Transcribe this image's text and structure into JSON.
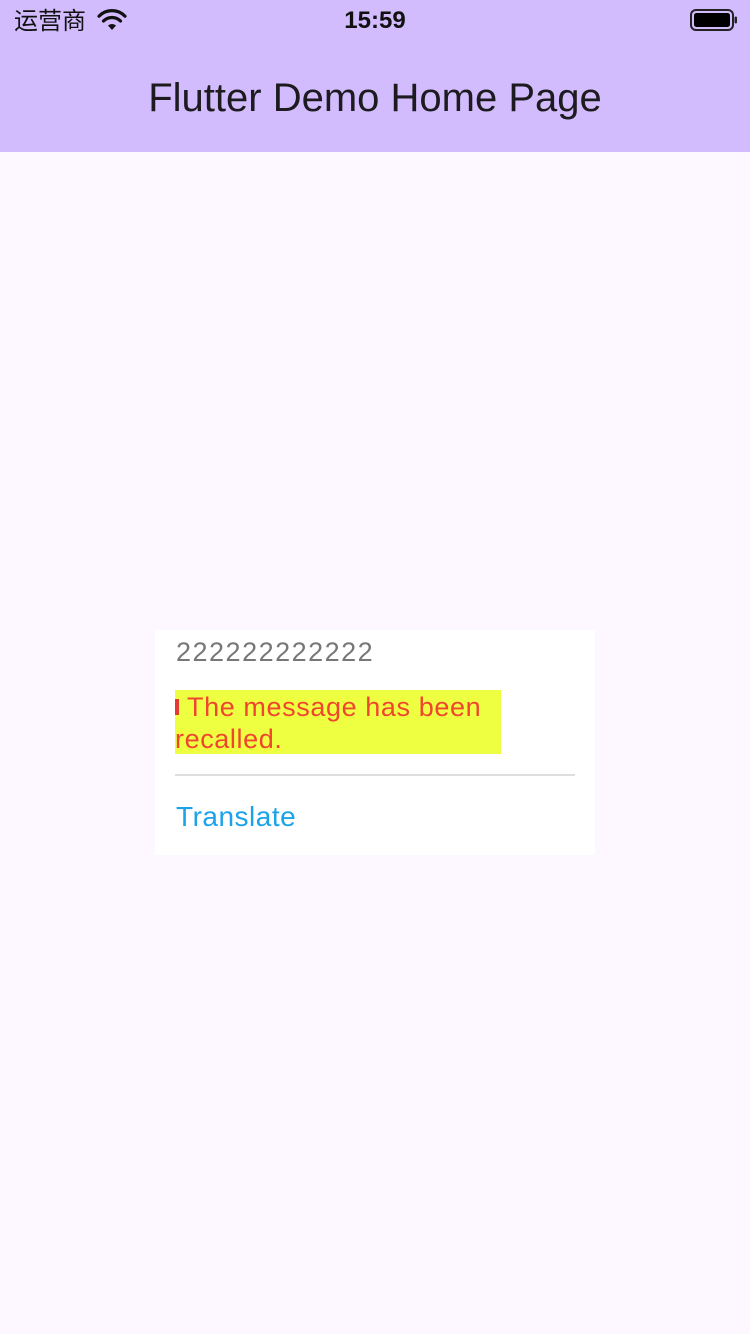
{
  "status_bar": {
    "carrier": "运营商",
    "time": "15:59",
    "wifi_icon": "wifi-icon",
    "battery_icon": "battery-full-icon"
  },
  "app_bar": {
    "title": "Flutter Demo Home Page",
    "background": "#d2bcfd"
  },
  "popup": {
    "original_text": "222222222222",
    "recall_message": "The message has been recalled.",
    "translate_label": "Translate"
  },
  "colors": {
    "page_background": "#fdf7ff",
    "highlight": "#eeff41",
    "recall_text": "#f0452e",
    "link": "#1aa3e8"
  }
}
